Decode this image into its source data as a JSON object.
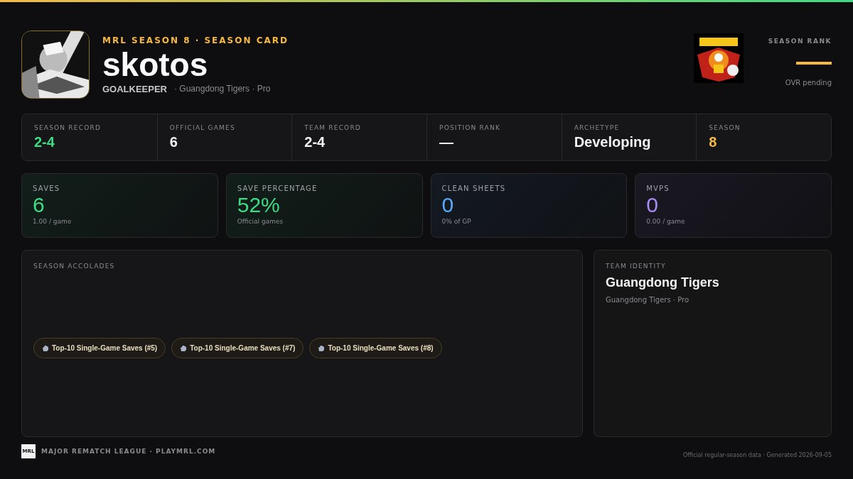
{
  "header": {
    "eyebrow": "MRL SEASON 8 · SEASON CARD",
    "player_name": "skotos",
    "position": "GOALKEEPER",
    "team_line": "· Guangdong Tigers · Pro"
  },
  "season_rank": {
    "label": "SEASON RANK",
    "note": "OVR pending"
  },
  "record_strip": [
    {
      "label": "SEASON RECORD",
      "value": "2-4",
      "color": "#3ddc84"
    },
    {
      "label": "OFFICIAL GAMES",
      "value": "6",
      "color": "#f2f2f2"
    },
    {
      "label": "TEAM RECORD",
      "value": "2-4",
      "color": "#f2f2f2"
    },
    {
      "label": "POSITION RANK",
      "value": "—",
      "color": "#f2f2f2"
    },
    {
      "label": "ARCHETYPE",
      "value": "Developing",
      "color": "#f2f2f2"
    },
    {
      "label": "SEASON",
      "value": "8",
      "color": "#f5b942"
    }
  ],
  "stat_cards": [
    {
      "label": "SAVES",
      "value": "6",
      "sub": "1.00 / game",
      "color": "#3ddc84"
    },
    {
      "label": "SAVE PERCENTAGE",
      "value": "52%",
      "sub": "Official games",
      "color": "#3ddc84"
    },
    {
      "label": "CLEAN SHEETS",
      "value": "0",
      "sub": "0% of GP",
      "color": "#5aa9f7"
    },
    {
      "label": "MVPS",
      "value": "0",
      "sub": "0.00 / game",
      "color": "#a98bf5"
    }
  ],
  "accolades": {
    "title": "SEASON ACCOLADES",
    "items": [
      "Top-10 Single-Game Saves (#5)",
      "Top-10 Single-Game Saves (#7)",
      "Top-10 Single-Game Saves (#8)"
    ]
  },
  "team_identity": {
    "title": "TEAM IDENTITY",
    "name": "Guangdong Tigers",
    "sub": "Guangdong Tigers · Pro"
  },
  "footer": {
    "logo_text": "MRL",
    "league": "MAJOR REMATCH LEAGUE · PLAYMRL.COM",
    "note": "Official regular-season data · Generated 2026-09-05"
  }
}
